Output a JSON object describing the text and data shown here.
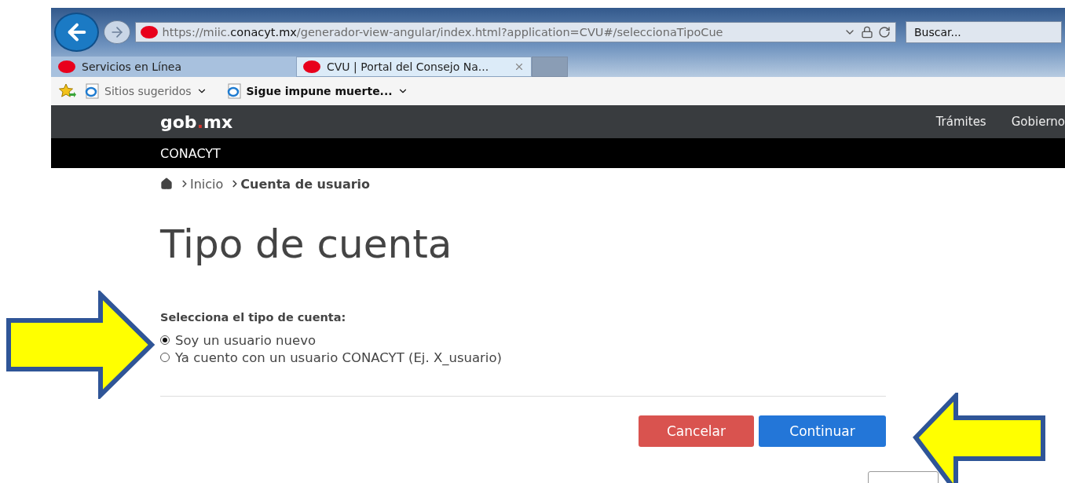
{
  "browser": {
    "url": "https://miic.**conacyt.mx**/generador-view-angular/index.html?application=CVU#/seleccionaTipoCue",
    "search": {
      "placeholder": "Buscar..."
    },
    "tabs": [
      {
        "label": "Servicios en Línea",
        "selected": false
      },
      {
        "label": "CVU | Portal del Consejo Na...",
        "selected": true
      }
    ],
    "favorites": [
      {
        "label": "Sitios sugeridos",
        "bold": false
      },
      {
        "label": "Sigue impune muerte...",
        "bold": true
      }
    ]
  },
  "header": {
    "logo": {
      "text": "gob",
      "accent": ".",
      "suffix": "mx"
    },
    "nav": [
      "Trámites",
      "Gobierno"
    ],
    "subtitle": "CONACYT"
  },
  "breadcrumb": [
    {
      "label": "Inicio",
      "current": false
    },
    {
      "label": "Cuenta de usuario",
      "current": true
    }
  ],
  "title": "Tipo de cuenta",
  "prompt": "Selecciona el tipo de cuenta:",
  "options": [
    {
      "label": "Soy un usuario nuevo",
      "selected": true
    },
    {
      "label": "Ya cuento con un usuario CONACYT (Ej. X_usuario)",
      "selected": false
    }
  ],
  "buttons": [
    {
      "label": "Cancelar",
      "kind": "danger"
    },
    {
      "label": "Continuar",
      "kind": "primary"
    }
  ]
}
